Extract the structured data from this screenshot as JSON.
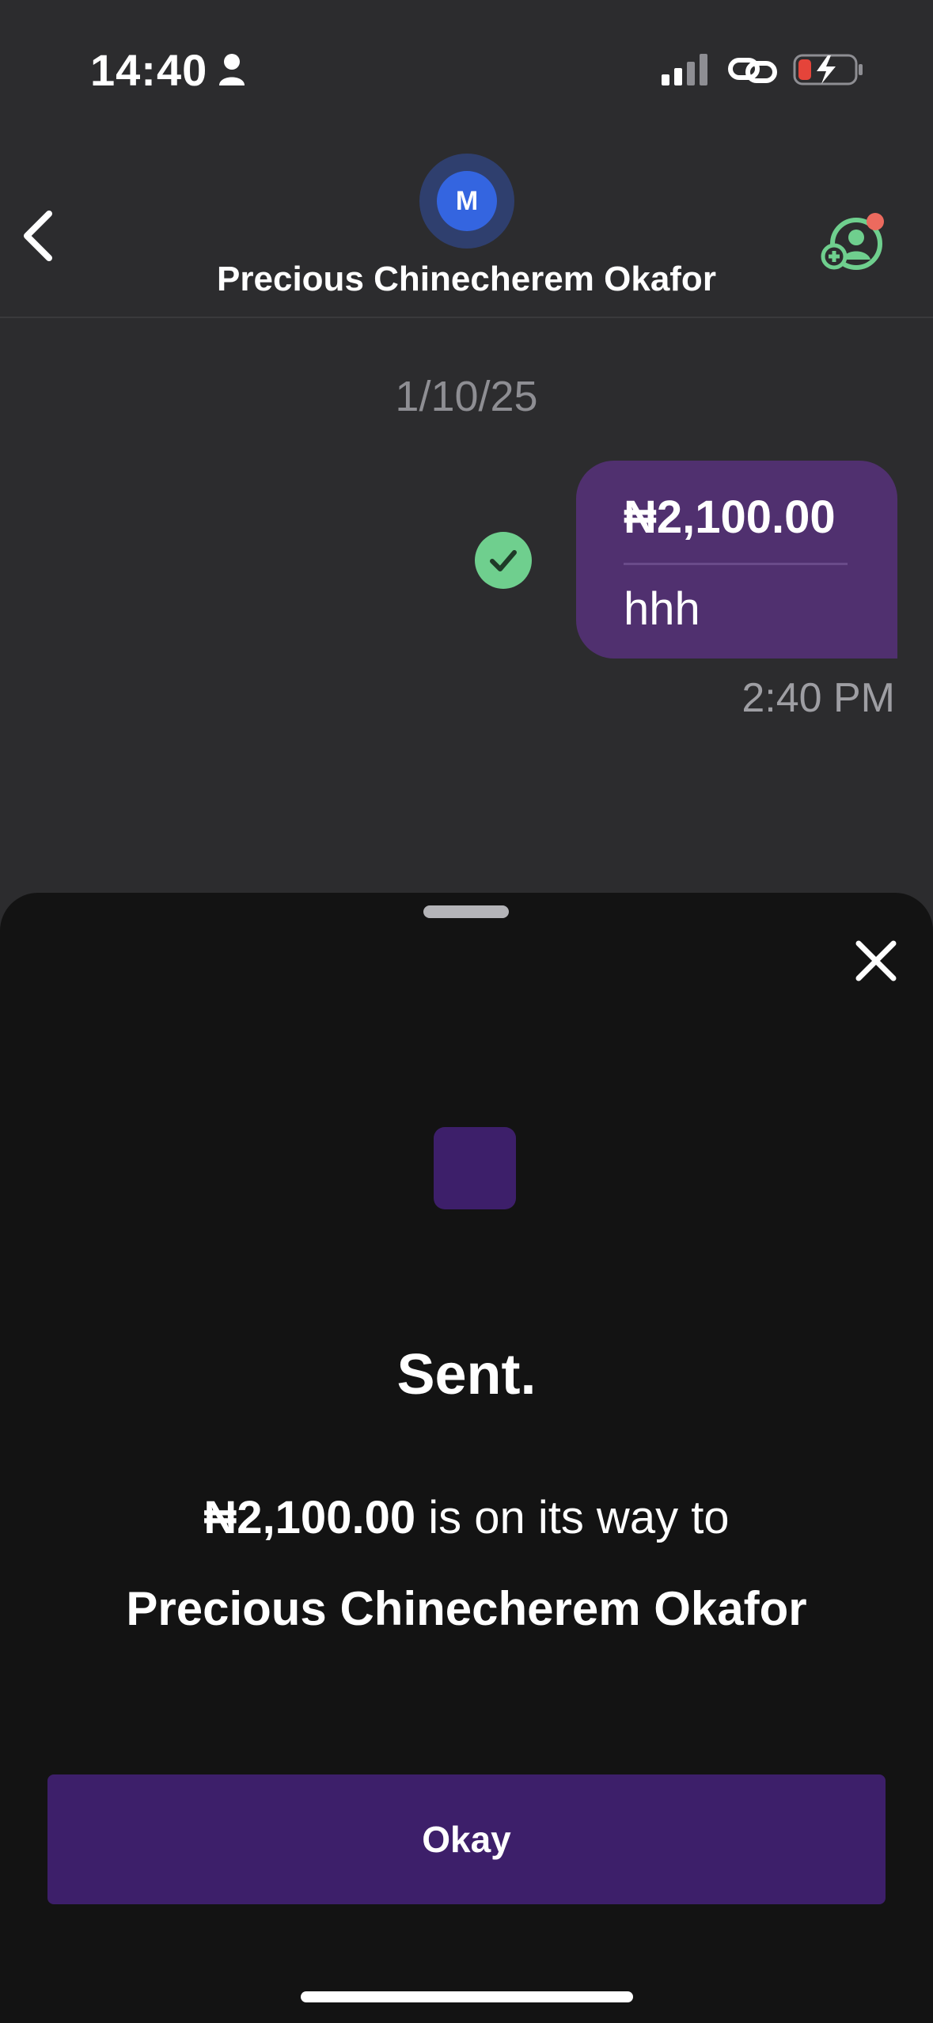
{
  "status_bar": {
    "time": "14:40",
    "icons": [
      "person-icon",
      "signal-icon",
      "link-icon",
      "battery-charging-icon"
    ]
  },
  "header": {
    "avatar_initial": "M",
    "contact_name": "Precious Chinecherem Okafor",
    "icons": [
      "chevron-left-icon",
      "add-contact-icon"
    ]
  },
  "chat": {
    "date": "1/10/25",
    "message": {
      "amount": "₦2,100.00",
      "note": "hhh",
      "time": "2:40 PM",
      "status_icon": "check-icon"
    }
  },
  "sheet": {
    "title": "Sent.",
    "amount": "₦2,100.00",
    "message_suffix": " is on its way to",
    "recipient": "Precious Chinecherem Okafor",
    "button_label": "Okay",
    "icons": [
      "close-icon"
    ]
  },
  "colors": {
    "background": "#2c2c2e",
    "sheet": "#131313",
    "accent_purple": "#3d1f6a",
    "bubble_purple": "#50306f",
    "success_green": "#6fcf8e",
    "avatar_blue": "#3465e0"
  }
}
